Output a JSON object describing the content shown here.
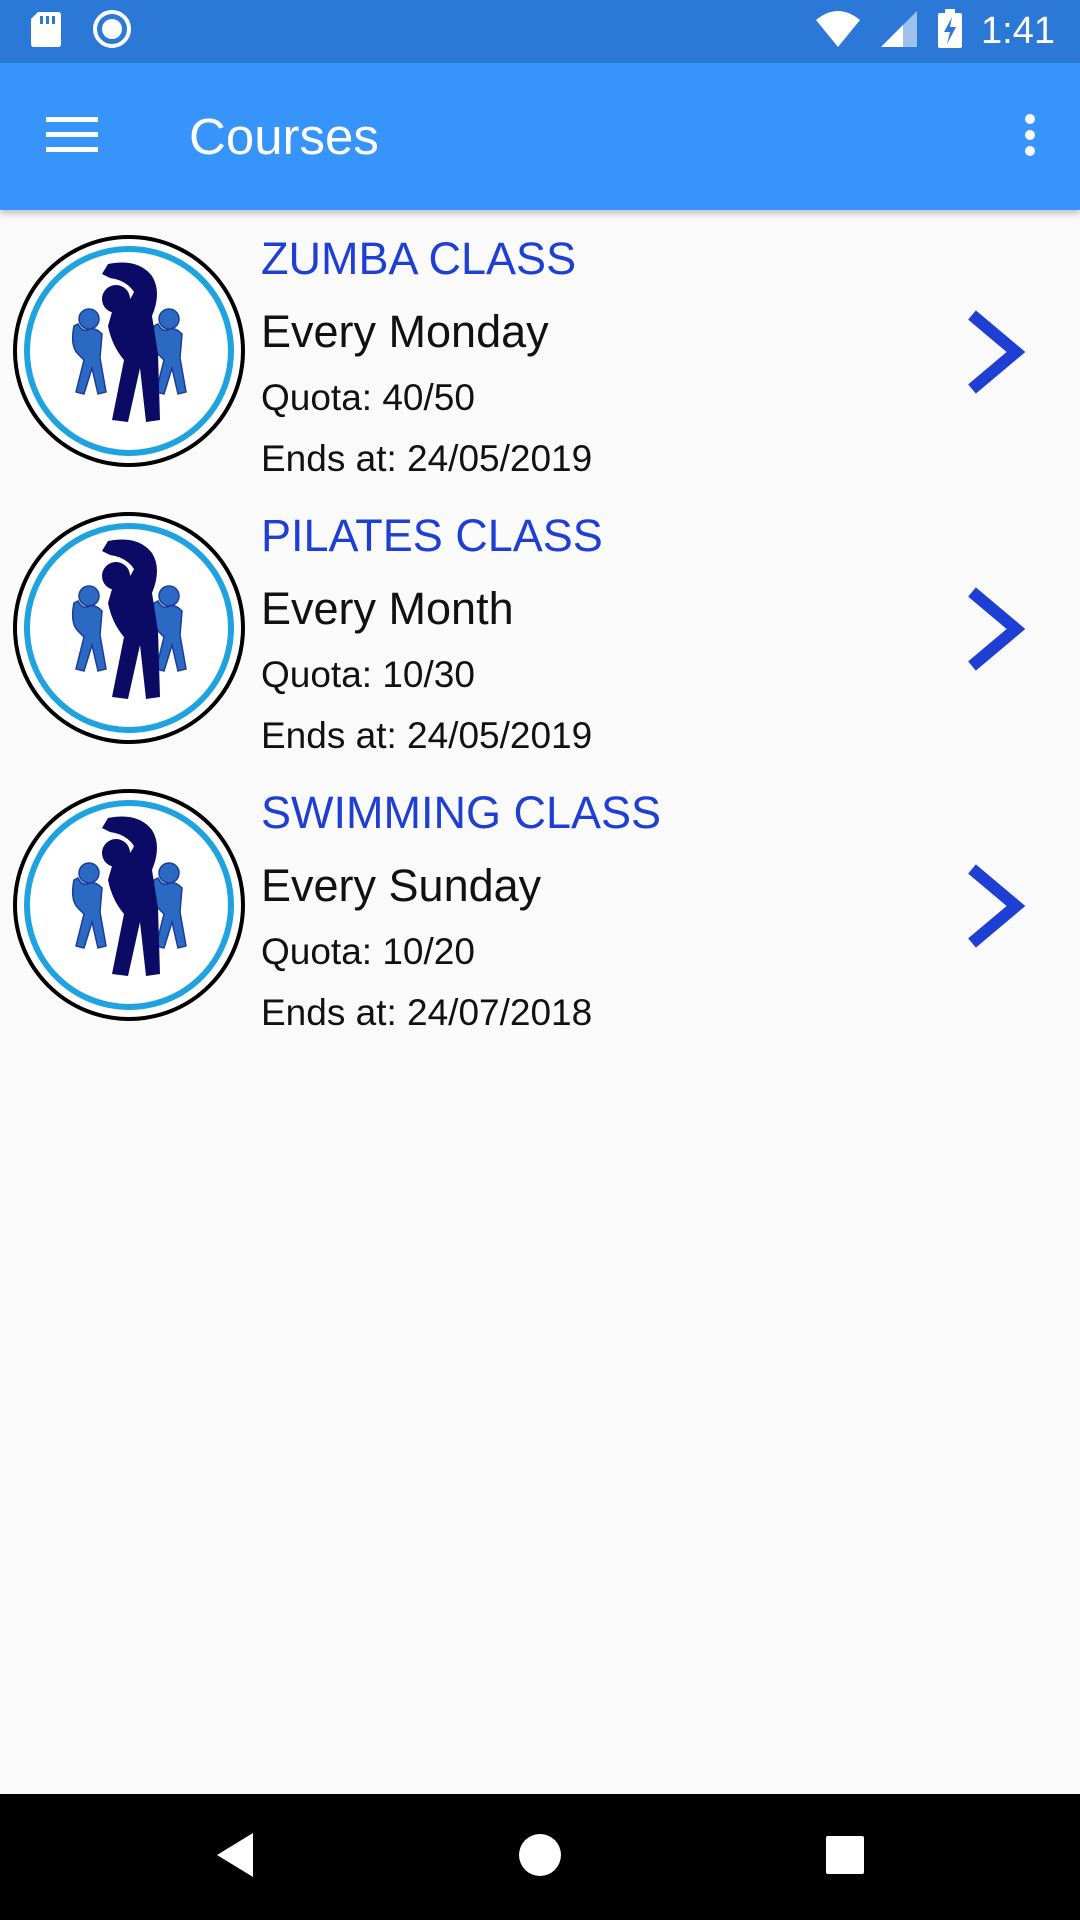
{
  "status_bar": {
    "time": "1:41",
    "left_icons": [
      "sd-card-icon",
      "sync-icon"
    ],
    "right_icons": [
      "wifi-icon",
      "cell-signal-icon",
      "battery-charging-icon"
    ]
  },
  "app_bar": {
    "title": "Courses",
    "menu_icon": "hamburger-menu-icon",
    "overflow_icon": "more-vert-icon",
    "color": "#3794FA"
  },
  "courses": [
    {
      "name": "ZUMBA CLASS",
      "schedule": "Every Monday",
      "quota": "Quota: 40/50",
      "ends": "Ends at: 24/05/2019"
    },
    {
      "name": "PILATES CLASS",
      "schedule": "Every Month",
      "quota": "Quota: 10/30",
      "ends": "Ends at: 24/05/2019"
    },
    {
      "name": "SWIMMING CLASS",
      "schedule": "Every Sunday",
      "quota": "Quota: 10/20",
      "ends": "Ends at: 24/07/2018"
    }
  ],
  "colors": {
    "status_bar": "#2C78D6",
    "course_name": "#1E3FD3",
    "chevron": "#1E3FD3",
    "background": "#FAFAFA"
  },
  "nav_bar": {
    "buttons": [
      "back-icon",
      "home-icon",
      "recents-icon"
    ]
  }
}
